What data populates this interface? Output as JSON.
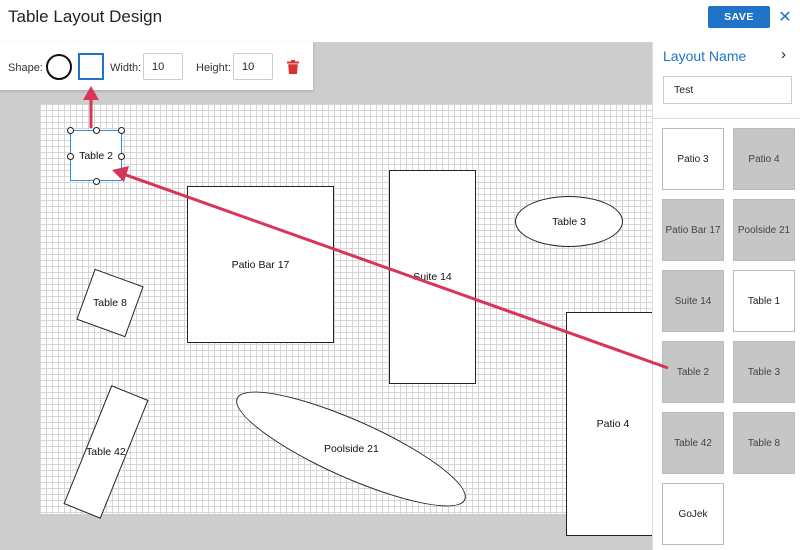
{
  "header": {
    "title": "Table Layout Design",
    "save_label": "SAVE",
    "close_glyph": "✕"
  },
  "toolbar": {
    "shape_label": "Shape:",
    "width_label": "Width:",
    "width_value": "10",
    "height_label": "Height:",
    "height_value": "10",
    "selected_shape": "square",
    "trash_color": "#d9342b"
  },
  "canvas": {
    "tables": [
      {
        "label": "Table 2",
        "shape": "rect",
        "selected": true
      },
      {
        "label": "Table 8",
        "shape": "rect"
      },
      {
        "label": "Table 42",
        "shape": "rect"
      },
      {
        "label": "Patio Bar 17",
        "shape": "rect"
      },
      {
        "label": "Suite 14",
        "shape": "rect"
      },
      {
        "label": "Table 3",
        "shape": "ellipse"
      },
      {
        "label": "Poolside 21",
        "shape": "ellipse"
      },
      {
        "label": "Patio 4",
        "shape": "rect"
      }
    ]
  },
  "sidebar": {
    "layout_name_label": "Layout Name",
    "chevron_glyph": "›",
    "layout_name_value": "Test",
    "tiles": [
      {
        "label": "Patio 3",
        "placed": false
      },
      {
        "label": "Patio 4",
        "placed": true
      },
      {
        "label": "Patio Bar 17",
        "placed": true
      },
      {
        "label": "Poolside 21",
        "placed": true
      },
      {
        "label": "Suite 14",
        "placed": true
      },
      {
        "label": "Table 1",
        "placed": false
      },
      {
        "label": "Table 2",
        "placed": true
      },
      {
        "label": "Table 3",
        "placed": true
      },
      {
        "label": "Table 42",
        "placed": true
      },
      {
        "label": "Table 8",
        "placed": true
      },
      {
        "label": "GoJek",
        "placed": false
      }
    ]
  },
  "annotation": {
    "arrow_color": "#d9345a"
  },
  "colors": {
    "accent": "#1f73c8",
    "canvas_bg": "#cdcdcd",
    "placed_tile": "#c6c6c6"
  }
}
